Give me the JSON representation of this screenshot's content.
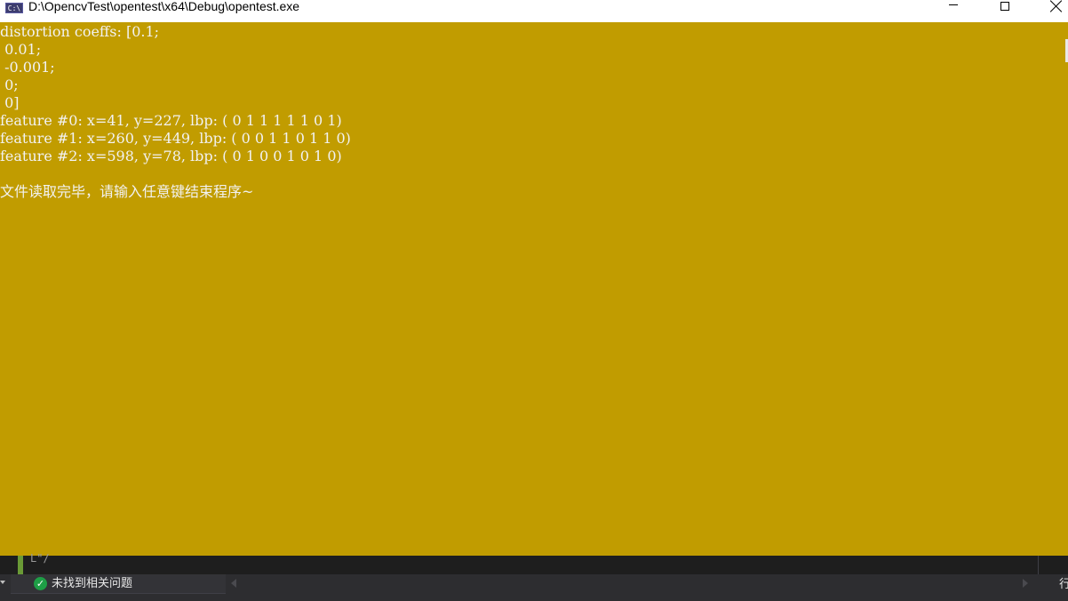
{
  "window": {
    "title": "D:\\OpencvTest\\opentest\\x64\\Debug\\opentest.exe",
    "icon_label": "C:\\",
    "icon": "console-app-icon",
    "controls": {
      "minimize": "minimize-icon",
      "maximize": "maximize-icon",
      "close": "close-icon"
    },
    "background_color": "#c19c00",
    "text_color": "#f2f2f2"
  },
  "console": {
    "lines": [
      "distortion coeffs: [0.1;",
      " 0.01;",
      " -0.001;",
      " 0;",
      " 0]",
      "feature #0: x=41, y=227, lbp: ( 0 1 1 1 1 1 0 1)",
      "feature #1: x=260, y=449, lbp: ( 0 0 1 1 0 1 1 0)",
      "feature #2: x=598, y=78, lbp: ( 0 1 0 0 1 0 1 0)",
      "",
      "文件读取完毕，请输入任意键结束程序~"
    ]
  },
  "ide": {
    "code_fragment": "L\"/",
    "status": {
      "icon": "check-circle-icon",
      "text": "未找到相关问题"
    },
    "row_label": "行"
  }
}
